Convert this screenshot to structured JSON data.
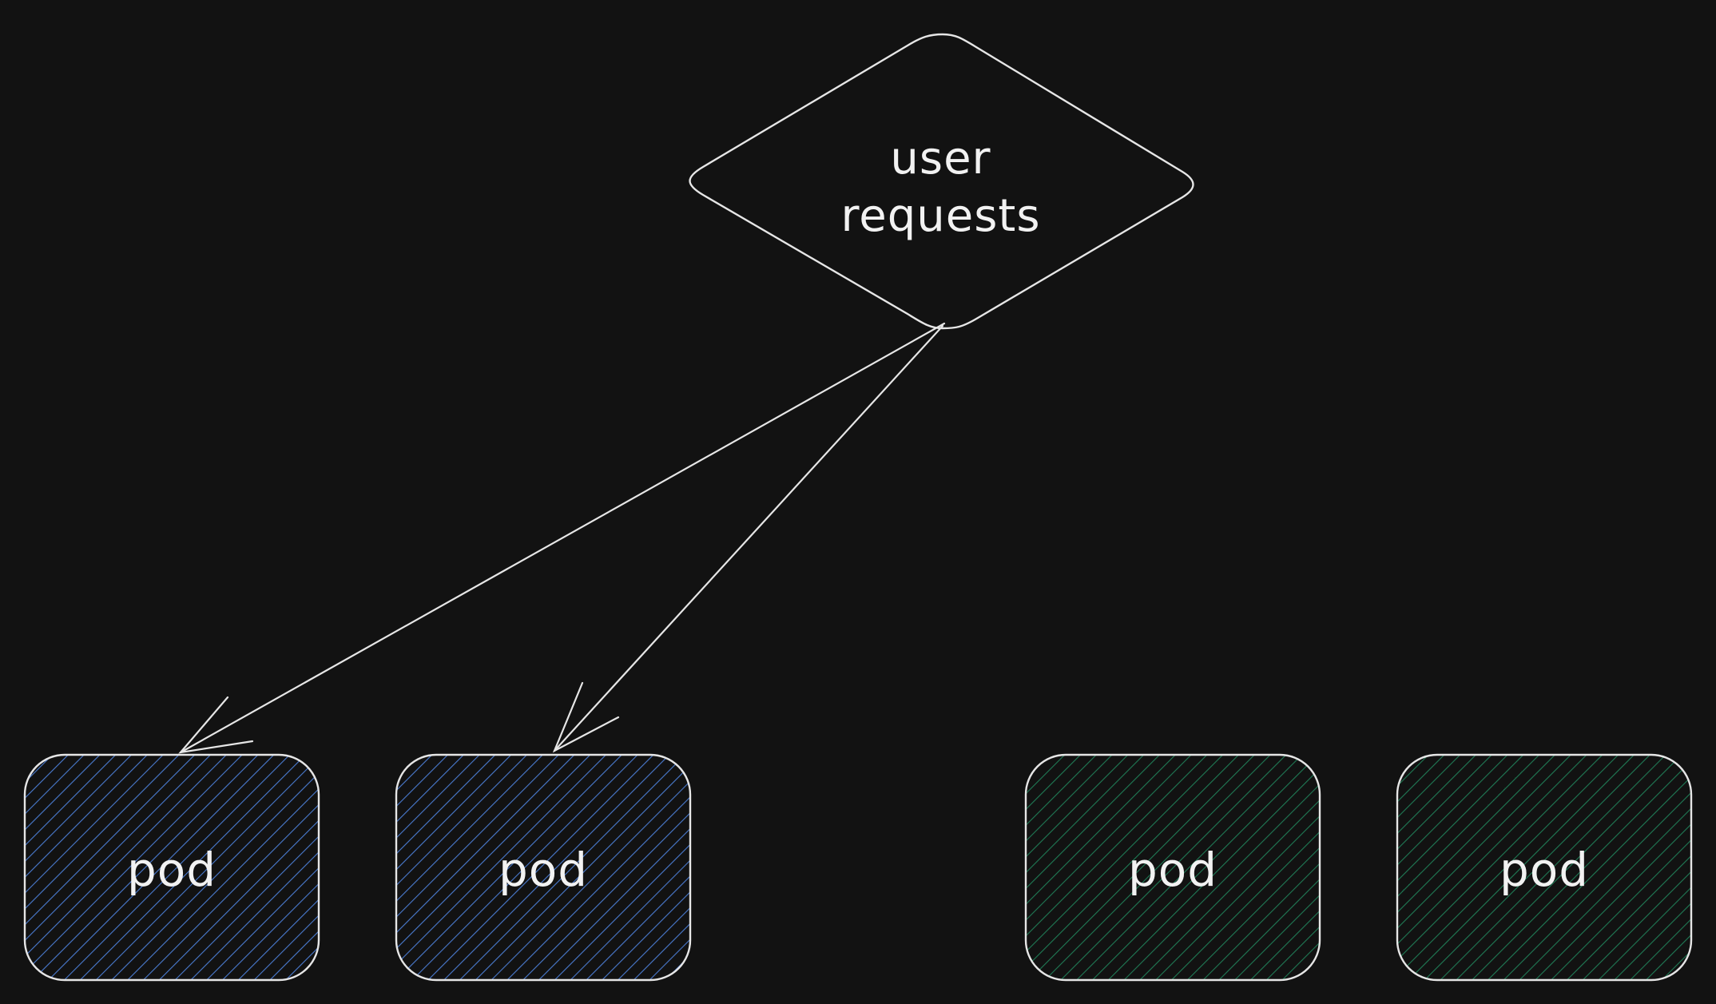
{
  "diagram": {
    "decision": {
      "label": "user\nrequests"
    },
    "pods": [
      {
        "label": "pod",
        "fill": "#4a7bd0"
      },
      {
        "label": "pod",
        "fill": "#4a7bd0"
      },
      {
        "label": "pod",
        "fill": "#1f7a55"
      },
      {
        "label": "pod",
        "fill": "#1f7a55"
      }
    ],
    "edges": [
      {
        "from": "decision",
        "to": "pod-1"
      },
      {
        "from": "decision",
        "to": "pod-2"
      }
    ],
    "colors": {
      "background": "#121212",
      "stroke": "#e6e6e6",
      "blue_group": "#4a7bd0",
      "green_group": "#1f7a55"
    }
  }
}
